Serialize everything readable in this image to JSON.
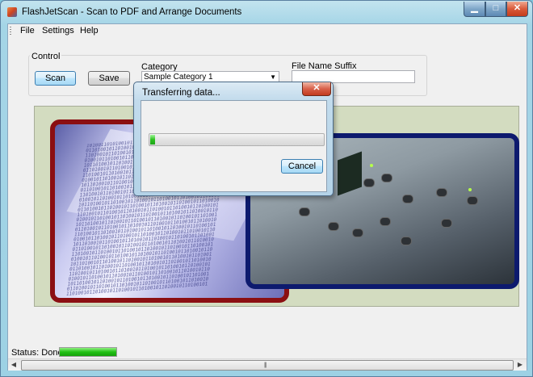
{
  "window": {
    "title": "FlashJetScan - Scan to PDF and Arrange Documents"
  },
  "icons": [
    "app-icon",
    "minimize-icon",
    "maximize-icon",
    "close-icon",
    "chevron-down-icon",
    "scroll-left-icon",
    "scroll-right-icon"
  ],
  "menu": {
    "items": [
      "File",
      "Settings",
      "Help"
    ]
  },
  "control": {
    "group_label": "Control",
    "scan_label": "Scan",
    "save_label": "Save",
    "category_label": "Category",
    "category_value": "Sample Category 1",
    "suffix_label": "File Name Suffix",
    "suffix_value": ""
  },
  "dialog": {
    "title": "Transferring data...",
    "progress": 0.03,
    "cancel_label": "Cancel"
  },
  "status": {
    "text": "Status: Done",
    "progress": 1.0
  },
  "colors": {
    "progress_green": "#2bc11f",
    "left_frame": "#8b0f12",
    "right_frame": "#0d1a6e",
    "panel_bg": "#d3dcc0"
  }
}
